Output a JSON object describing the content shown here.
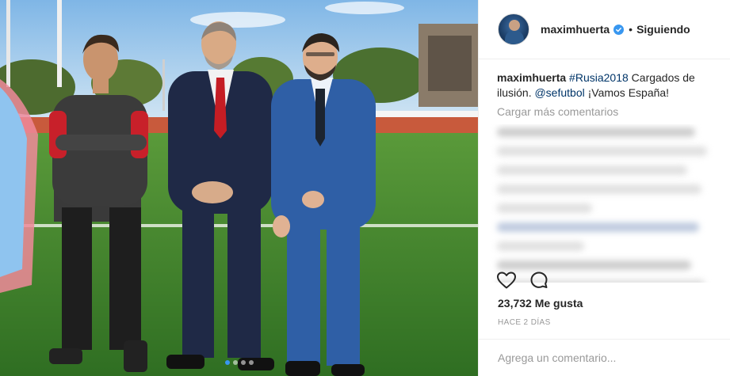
{
  "post": {
    "username": "maximhuerta",
    "follow_separator": "•",
    "follow_status": "Siguiendo",
    "caption_user": "maximhuerta",
    "caption_hashtag": "#Rusia2018",
    "caption_text_1": " Cargados de ilusión. ",
    "caption_mention": "@sefutbol",
    "caption_text_2": " ¡Vamos España!",
    "load_more": "Cargar más comentarios",
    "likes": "23,732 Me gusta",
    "time_ago": "HACE 2 DÍAS",
    "comment_placeholder": "Agrega un comentario..."
  },
  "carousel": {
    "count": 4,
    "active_index": 0
  },
  "colors": {
    "link": "#003569",
    "verified": "#3897f0",
    "muted": "#999999",
    "pitch": "#3f8a2e",
    "sky": "#9fc9ea"
  },
  "icons": [
    "verified-badge-icon",
    "heart-icon",
    "comment-icon"
  ]
}
